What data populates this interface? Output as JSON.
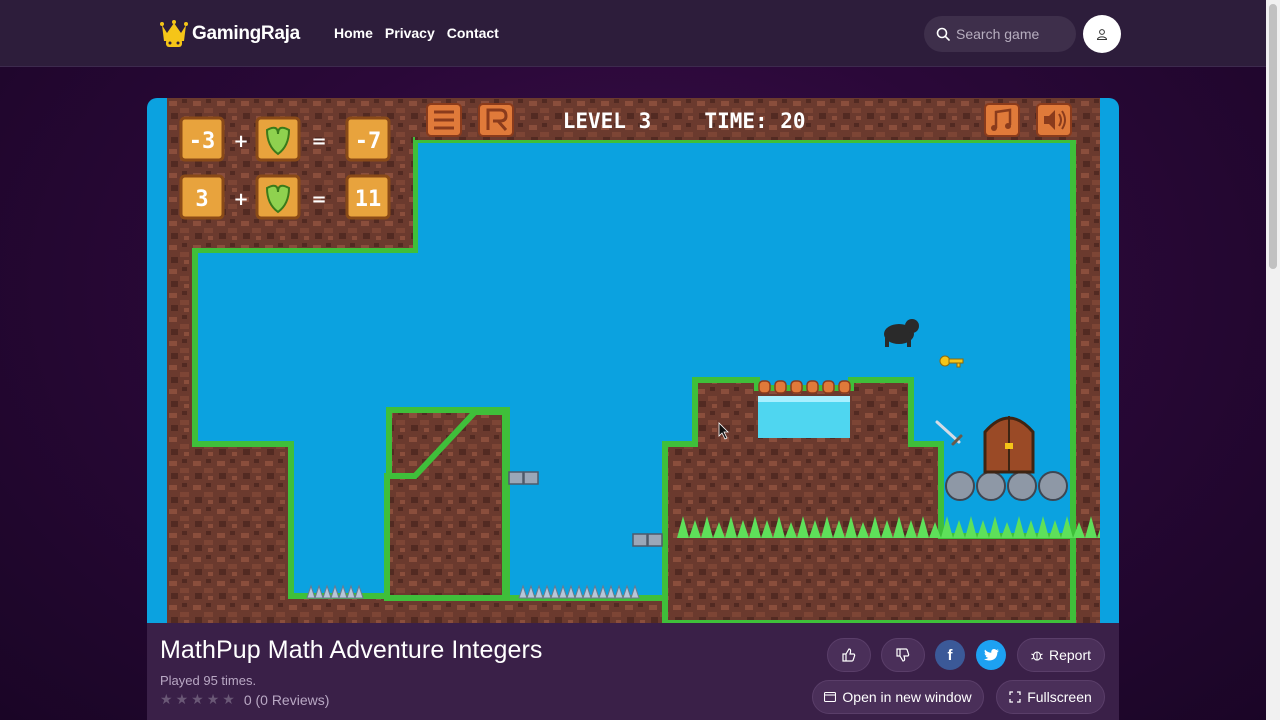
{
  "header": {
    "logo_text": "GamingRaja",
    "nav": [
      "Home",
      "Privacy",
      "Contact"
    ],
    "search_placeholder": "Search game"
  },
  "game": {
    "hud": {
      "level_label": "LEVEL 3",
      "time_label": "TIME: 20"
    },
    "equations": [
      {
        "a": "-3",
        "op": "+",
        "eq": "=",
        "result": "-7"
      },
      {
        "a": "3",
        "op": "+",
        "eq": "=",
        "result": "11"
      }
    ]
  },
  "info": {
    "title": "MathPup Math Adventure Integers",
    "played": "Played 95 times.",
    "rating_text": "0 (0 Reviews)",
    "report_label": "Report",
    "open_window_label": "Open in new window",
    "fullscreen_label": "Fullscreen"
  },
  "colors": {
    "header_bg": "#2d1d3b",
    "sky": "#0ba2e0",
    "dirt": "#6b3a2e",
    "grass": "#3fbf3a",
    "tile_orange": "#e8a33d",
    "facebook": "#3b5998",
    "twitter": "#1da1f2"
  }
}
